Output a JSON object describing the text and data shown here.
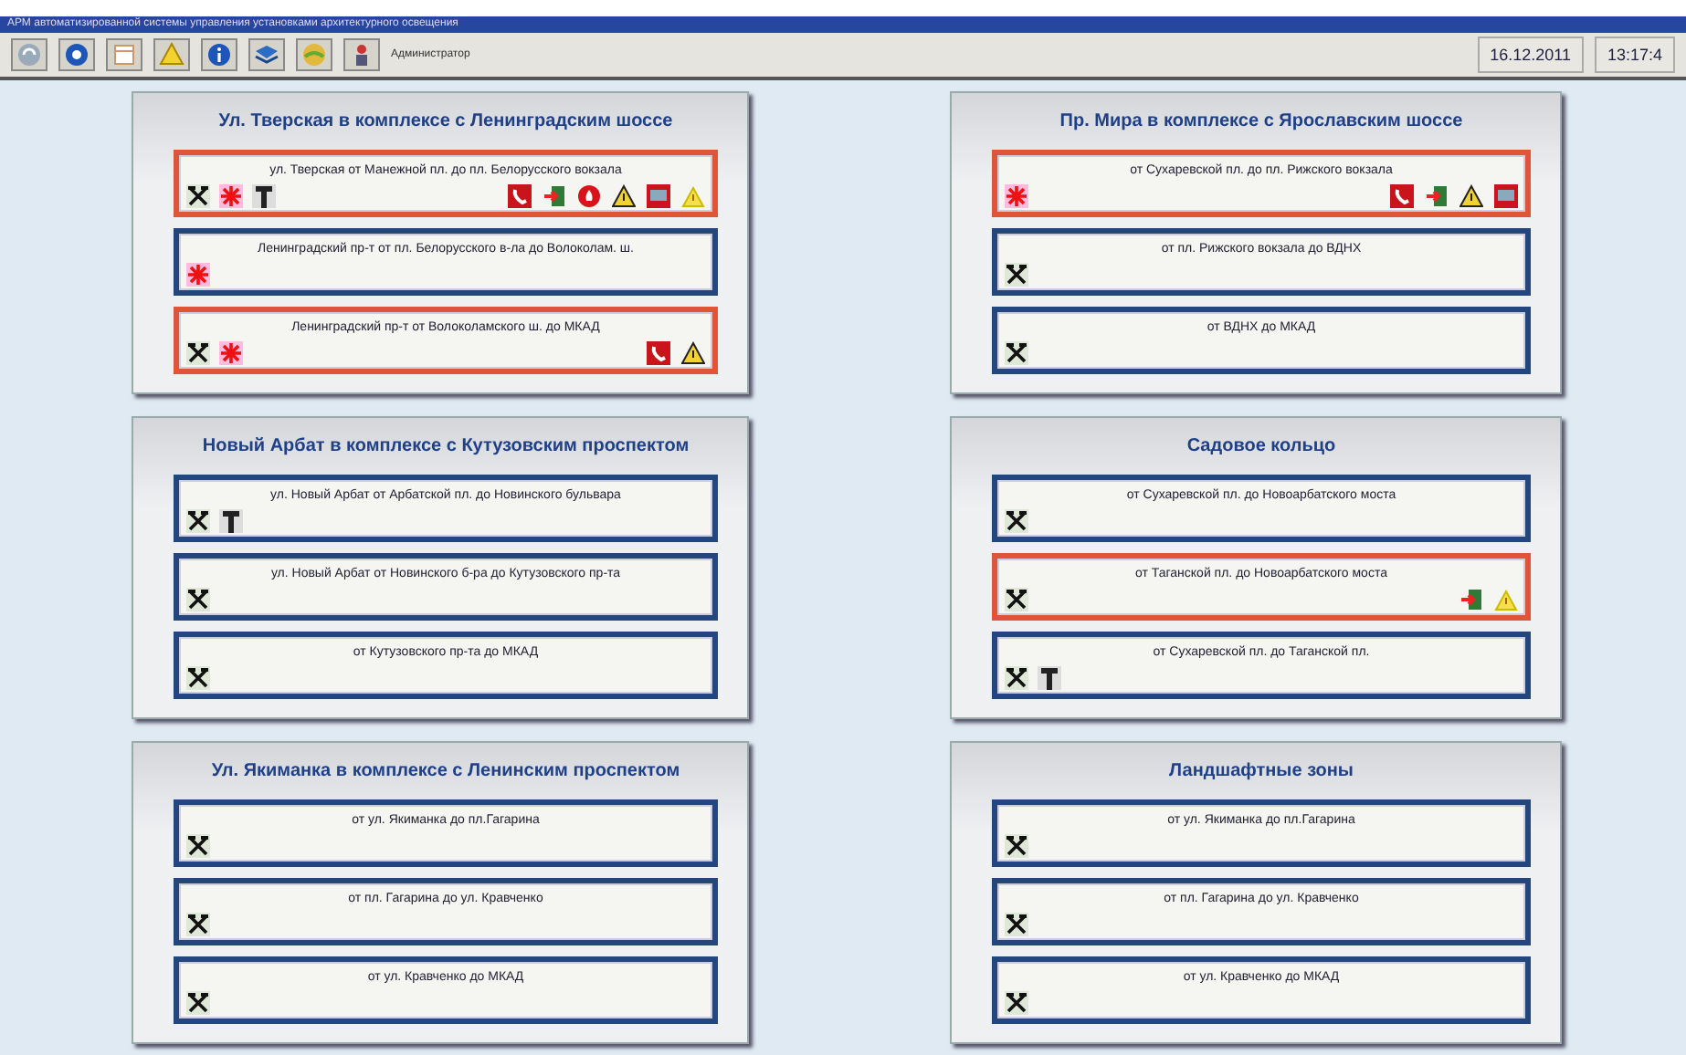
{
  "window": {
    "title": "АРМ автоматизированной системы управления установками архитектурного освещения"
  },
  "toolbar": {
    "buttons": [
      {
        "kind": "refresh"
      },
      {
        "kind": "back"
      },
      {
        "kind": "table"
      },
      {
        "kind": "warning"
      },
      {
        "kind": "info"
      },
      {
        "kind": "book"
      },
      {
        "kind": "globe"
      },
      {
        "kind": "user"
      }
    ],
    "user": "Администратор",
    "date": "16.12.2011",
    "time": "13:17:4"
  },
  "panels": [
    {
      "title": "Ул. Тверская в комплексе с Ленинградским шоссе",
      "routes": [
        {
          "name": "ул. Тверская от Манежной пл. до пл. Белорусского вокзала",
          "alert": true,
          "left_icons": [
            {
              "kind": "tools"
            },
            {
              "kind": "cross"
            },
            {
              "kind": "pillar"
            }
          ],
          "right_icons": [
            {
              "kind": "phone"
            },
            {
              "kind": "exit"
            },
            {
              "kind": "fire"
            },
            {
              "kind": "warning"
            },
            {
              "kind": "monitor"
            },
            {
              "kind": "caution"
            }
          ]
        },
        {
          "name": "Ленинградский пр-т от пл. Белорусского в-ла до Волоколам. ш.",
          "alert": false,
          "left_icons": [
            {
              "kind": "cross"
            }
          ]
        },
        {
          "name": "Ленинградский пр-т от Волоколамского ш. до МКАД",
          "alert": true,
          "left_icons": [
            {
              "kind": "tools"
            },
            {
              "kind": "cross"
            }
          ],
          "right_icons": [
            {
              "kind": "phone"
            },
            {
              "kind": "warning"
            }
          ]
        }
      ]
    },
    {
      "title": "Пр. Мира в комплексе с Ярославским шоссе",
      "routes": [
        {
          "name": "от Сухаревской пл. до пл. Рижского вокзала",
          "alert": true,
          "left_icons": [
            {
              "kind": "cross"
            }
          ],
          "right_icons": [
            {
              "kind": "phone"
            },
            {
              "kind": "exit"
            },
            {
              "kind": "warning"
            },
            {
              "kind": "monitor"
            }
          ]
        },
        {
          "name": "от пл. Рижского вокзала до ВДНХ",
          "alert": false,
          "left_icons": [
            {
              "kind": "tools"
            }
          ]
        },
        {
          "name": "от ВДНХ до МКАД",
          "alert": false,
          "left_icons": [
            {
              "kind": "tools"
            }
          ]
        }
      ]
    },
    {
      "title": "Новый Арбат в комплексе с Кутузовским проспектом",
      "routes": [
        {
          "name": "ул. Новый Арбат от Арбатской пл. до Новинского бульвара",
          "alert": false,
          "left_icons": [
            {
              "kind": "tools"
            },
            {
              "kind": "pillar"
            }
          ]
        },
        {
          "name": "ул. Новый Арбат от Новинского б-ра до Кутузовского пр-та",
          "alert": false,
          "left_icons": [
            {
              "kind": "tools"
            }
          ]
        },
        {
          "name": "от Кутузовского пр-та до МКАД",
          "alert": false,
          "left_icons": [
            {
              "kind": "tools"
            }
          ]
        }
      ]
    },
    {
      "title": "Садовое кольцо",
      "routes": [
        {
          "name": "от Сухаревской пл. до Новоарбатского моста",
          "alert": false,
          "left_icons": [
            {
              "kind": "tools"
            }
          ]
        },
        {
          "name": "от Таганской пл. до Новоарбатского моста",
          "alert": true,
          "left_icons": [
            {
              "kind": "tools"
            }
          ],
          "right_icons": [
            {
              "kind": "exit"
            },
            {
              "kind": "caution"
            }
          ]
        },
        {
          "name": "от Сухаревской пл. до Таганской пл.",
          "alert": false,
          "left_icons": [
            {
              "kind": "tools"
            },
            {
              "kind": "pillar"
            }
          ]
        }
      ]
    },
    {
      "title": "Ул. Якиманка в комплексе с Ленинским проспектом",
      "routes": [
        {
          "name": "от ул. Якиманка до пл.Гагарина",
          "alert": false,
          "left_icons": [
            {
              "kind": "tools"
            }
          ]
        },
        {
          "name": "от пл. Гагарина до ул. Кравченко",
          "alert": false,
          "left_icons": [
            {
              "kind": "tools"
            }
          ]
        },
        {
          "name": "от ул. Кравченко до МКАД",
          "alert": false,
          "left_icons": [
            {
              "kind": "tools"
            }
          ]
        }
      ]
    },
    {
      "title": "Ландшафтные зоны",
      "routes": [
        {
          "name": "от ул. Якиманка до пл.Гагарина",
          "alert": false,
          "left_icons": [
            {
              "kind": "tools"
            }
          ]
        },
        {
          "name": "от пл. Гагарина до ул. Кравченко",
          "alert": false,
          "left_icons": [
            {
              "kind": "tools"
            }
          ]
        },
        {
          "name": "от ул. Кравченко до МКАД",
          "alert": false,
          "left_icons": [
            {
              "kind": "tools"
            }
          ]
        }
      ]
    }
  ]
}
